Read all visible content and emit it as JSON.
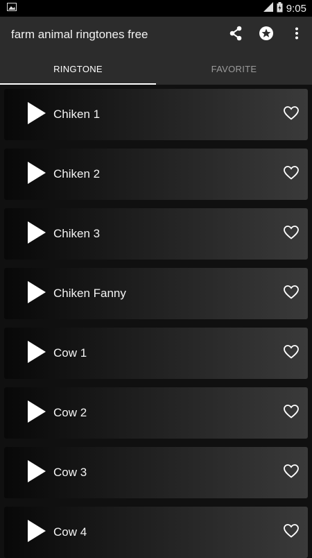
{
  "status_bar": {
    "time": "9:05"
  },
  "toolbar": {
    "title": "farm animal ringtones free",
    "actions": [
      "share-icon",
      "star-circle-icon",
      "more-vert-icon"
    ]
  },
  "tabs": [
    {
      "label": "RINGTONE",
      "active": true
    },
    {
      "label": "FAVORITE",
      "active": false
    }
  ],
  "ringtones": [
    {
      "label": "Chiken 1"
    },
    {
      "label": "Chiken 2"
    },
    {
      "label": "Chiken 3"
    },
    {
      "label": "Chiken Fanny"
    },
    {
      "label": "Cow 1"
    },
    {
      "label": "Cow 2"
    },
    {
      "label": "Cow 3"
    },
    {
      "label": "Cow 4"
    }
  ],
  "colors": {
    "toolbar": "#2c2c2c",
    "background": "#101010",
    "accent": "#ffffff"
  }
}
